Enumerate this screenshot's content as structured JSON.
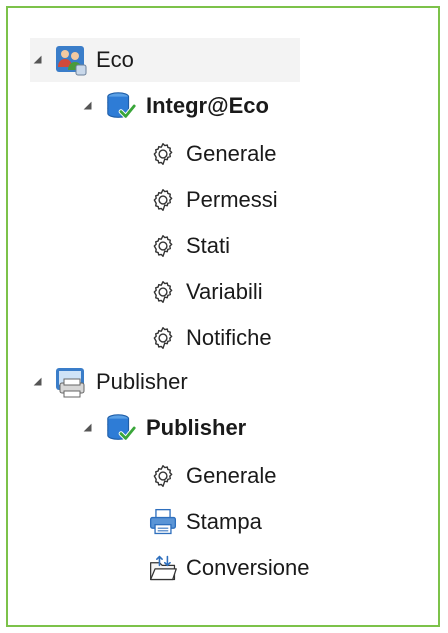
{
  "tree": {
    "eco": {
      "label": "Eco",
      "db": {
        "label": "Integr@Eco",
        "items": [
          "Generale",
          "Permessi",
          "Stati",
          "Variabili",
          "Notifiche"
        ]
      }
    },
    "publisher": {
      "label": "Publisher",
      "db": {
        "label": "Publisher",
        "items": [
          "Generale",
          "Stampa",
          "Conversione"
        ]
      }
    }
  },
  "colors": {
    "border": "#7cc24a",
    "db_blue": "#2e7cd6",
    "check_green": "#3aa63a"
  },
  "icons": {
    "eco": "users-group-icon",
    "database": "database-check-icon",
    "settings": "gear-icon",
    "publisher": "printer-computer-icon",
    "stampa": "printer-icon",
    "conversione": "conversion-folder-icon"
  }
}
